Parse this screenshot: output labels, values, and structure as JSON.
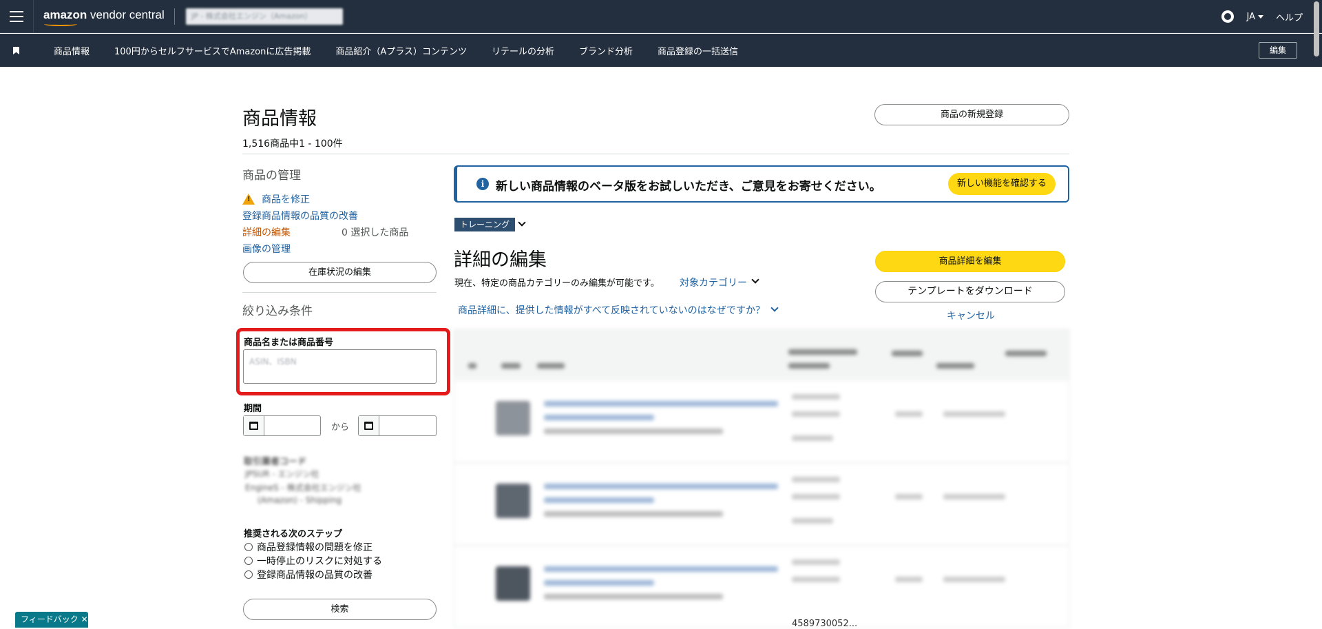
{
  "topbar": {
    "brand_bold": "amazon",
    "brand_rest": " vendor central",
    "account_blurred": "JP - 株式会社エンジン（Amazon）",
    "lang": "JA",
    "help": "ヘルプ",
    "icons": [
      "menu-icon",
      "gear-icon"
    ]
  },
  "nav": {
    "items": [
      "商品情報",
      "100円からセルフサービスでAmazonに広告掲載",
      "商品紹介（Aプラス）コンテンツ",
      "リテールの分析",
      "ブランド分析",
      "商品登録の一括送信"
    ],
    "edit": "編集"
  },
  "page": {
    "title": "商品情報",
    "count": "1,516商品中1 - 100件",
    "new_product": "商品の新規登録"
  },
  "manage": {
    "heading": "商品の管理",
    "fix": "商品を修正",
    "quality": "登録商品情報の品質の改善",
    "edit_details": "詳細の編集",
    "selected": "0  選択した商品",
    "images": "画像の管理",
    "inventory_btn": "在庫状況の編集"
  },
  "filters": {
    "heading": "絞り込み条件",
    "search_label": "商品名または商品番号",
    "search_placeholder": "ASIN、ISBN",
    "period_label": "期間",
    "from": "から",
    "vendor_label": "取引業者コード",
    "vendor_items": [
      "JPSUR - エンジン社",
      "EngineS - 株式会社エンジン社",
      "(Amazon) - Shipping"
    ],
    "steps_label": "推奨される次のステップ",
    "steps": [
      "商品登録情報の問題を修正",
      "一時停止のリスクに対処する",
      "登録商品情報の品質の改善"
    ],
    "search_btn": "検索"
  },
  "banner": {
    "message": "新しい商品情報のベータ版をお試しいただき、ご意見をお寄せください。",
    "button": "新しい機能を確認する"
  },
  "edit_section": {
    "chip": "トレーニング",
    "heading": "詳細の編集",
    "desc": "現在、特定の商品カテゴリーのみ編集が可能です。",
    "target_link": "対象カテゴリー",
    "why_link": "商品詳細に、提供した情報がすべて反映されていないのはなぜですか？",
    "edit_btn": "商品詳細を編集",
    "download_btn": "テンプレートをダウンロード",
    "cancel": "キャンセル"
  },
  "table": {
    "tail_number": "4589730052..."
  },
  "feedback": "フィードバック ✕",
  "colors": {
    "header_bg": "#232f3e",
    "link": "#2162a1",
    "yellow_btn": "#ffd814",
    "highlight": "#e31b1b"
  }
}
